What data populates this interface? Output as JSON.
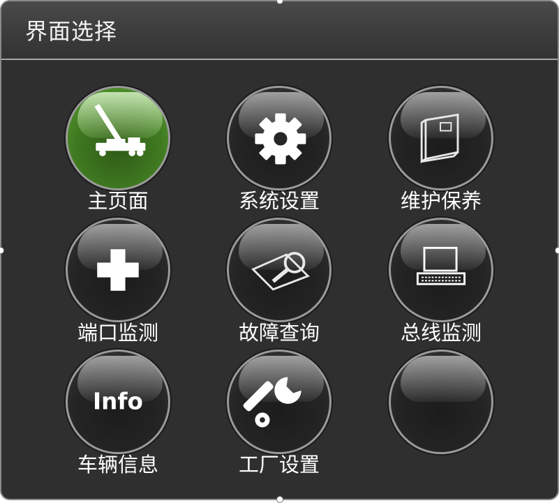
{
  "window": {
    "title": "界面选择"
  },
  "tiles": [
    {
      "label": "主页面",
      "icon": "crane-truck-icon",
      "active": true
    },
    {
      "label": "系统设置",
      "icon": "gear-icon",
      "active": false
    },
    {
      "label": "维护保养",
      "icon": "book-icon",
      "active": false
    },
    {
      "label": "端口监测",
      "icon": "plus-icon",
      "active": false
    },
    {
      "label": "故障查询",
      "icon": "magnifier-icon",
      "active": false
    },
    {
      "label": "总线监测",
      "icon": "laptop-icon",
      "active": false
    },
    {
      "label": "车辆信息",
      "icon": "info-icon",
      "icon_text": "Info",
      "active": false
    },
    {
      "label": "工厂设置",
      "icon": "wrench-icon",
      "active": false
    },
    {
      "label": "",
      "icon": "empty-icon",
      "active": false
    }
  ],
  "colors": {
    "panel_bg": "#2f2f2f",
    "active_green": "#4c8c28",
    "text": "#ffffff"
  }
}
